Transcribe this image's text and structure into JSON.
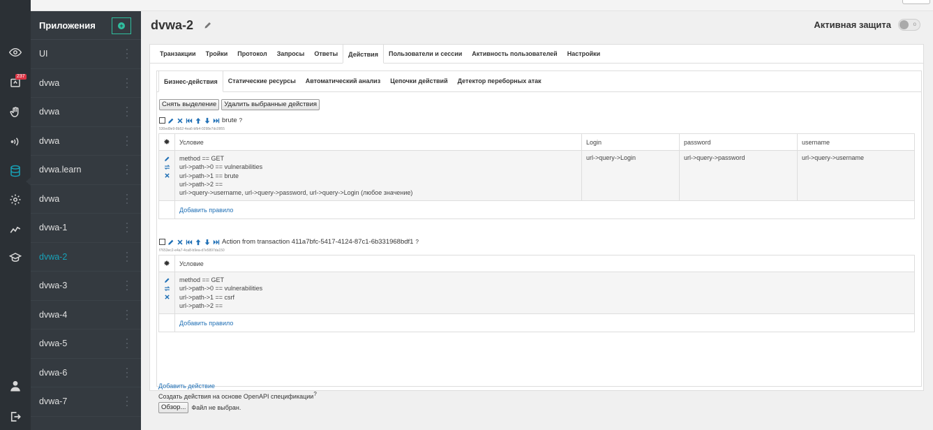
{
  "rail": {
    "badge": "237",
    "icons": [
      "eye-icon",
      "notifications-icon",
      "hand-icon",
      "signal-icon",
      "database-icon",
      "settings-icon",
      "analytics-icon",
      "graduation-icon",
      "user-icon",
      "logout-icon"
    ]
  },
  "apps": {
    "title": "Приложения",
    "add_icon": "plus-circle-icon",
    "items": [
      {
        "label": "UI",
        "active": false
      },
      {
        "label": "dvwa",
        "active": false
      },
      {
        "label": "dvwa",
        "active": false
      },
      {
        "label": "dvwa",
        "active": false
      },
      {
        "label": "dvwa.learn",
        "active": false
      },
      {
        "label": "dvwa",
        "active": false
      },
      {
        "label": "dvwa-1",
        "active": false
      },
      {
        "label": "dvwa-2",
        "active": true
      },
      {
        "label": "dvwa-3",
        "active": false
      },
      {
        "label": "dvwa-4",
        "active": false
      },
      {
        "label": "dvwa-5",
        "active": false
      },
      {
        "label": "dvwa-6",
        "active": false
      },
      {
        "label": "dvwa-7",
        "active": false
      }
    ]
  },
  "header": {
    "app_name": "dvwa-2",
    "protect_label": "Активная защита"
  },
  "tabs": [
    "Транзакции",
    "Тройки",
    "Протокол",
    "Запросы",
    "Ответы",
    "Действия",
    "Пользователи и сессии",
    "Активность пользователей",
    "Настройки"
  ],
  "subtabs": [
    "Бизнес-действия",
    "Статические ресурсы",
    "Автоматический анализ",
    "Цепочки действий",
    "Детектор переборных атак"
  ],
  "buttons": {
    "deselect": "Снять выделение",
    "delete_selected": "Удалить выбранные действия"
  },
  "actions": [
    {
      "name": "brute",
      "uid": "530ed9e9-8b52-4ea6-bfb4-0298e7dc0955",
      "cond_header": "Условие",
      "columns": [
        "Login",
        "password",
        "username"
      ],
      "conditions": [
        "method == GET",
        "url->path->0 == vulnerabilities",
        "url->path->1 == brute",
        "url->path->2 ==",
        "url->query->username, url->query->password, url->query->Login (любое значение)"
      ],
      "values": [
        "url->query->Login",
        "url->query->password",
        "url->query->username"
      ],
      "add_rule": "Добавить правило"
    },
    {
      "name": "Action from transaction 411a7bfc-5417-4124-87c1-6b331968bdf1",
      "uid": "f7653ec2-e4a7-4ca8-b9ea-d7e5897da150",
      "cond_header": "Условие",
      "conditions": [
        "method == GET",
        "url->path->0 == vulnerabilities",
        "url->path->1 == csrf",
        "url->path->2 =="
      ],
      "add_rule": "Добавить правило"
    }
  ],
  "footer": {
    "add_action": "Добавить действие",
    "openapi": "Создать действия на основе OpenAPI спецификации",
    "browse": "Обзор...",
    "no_file": "Файл не выбран."
  },
  "colors": {
    "accent": "#17a2b8",
    "link": "#1f6fb5",
    "sidebar": "#343a40",
    "rail": "#2b3035"
  }
}
